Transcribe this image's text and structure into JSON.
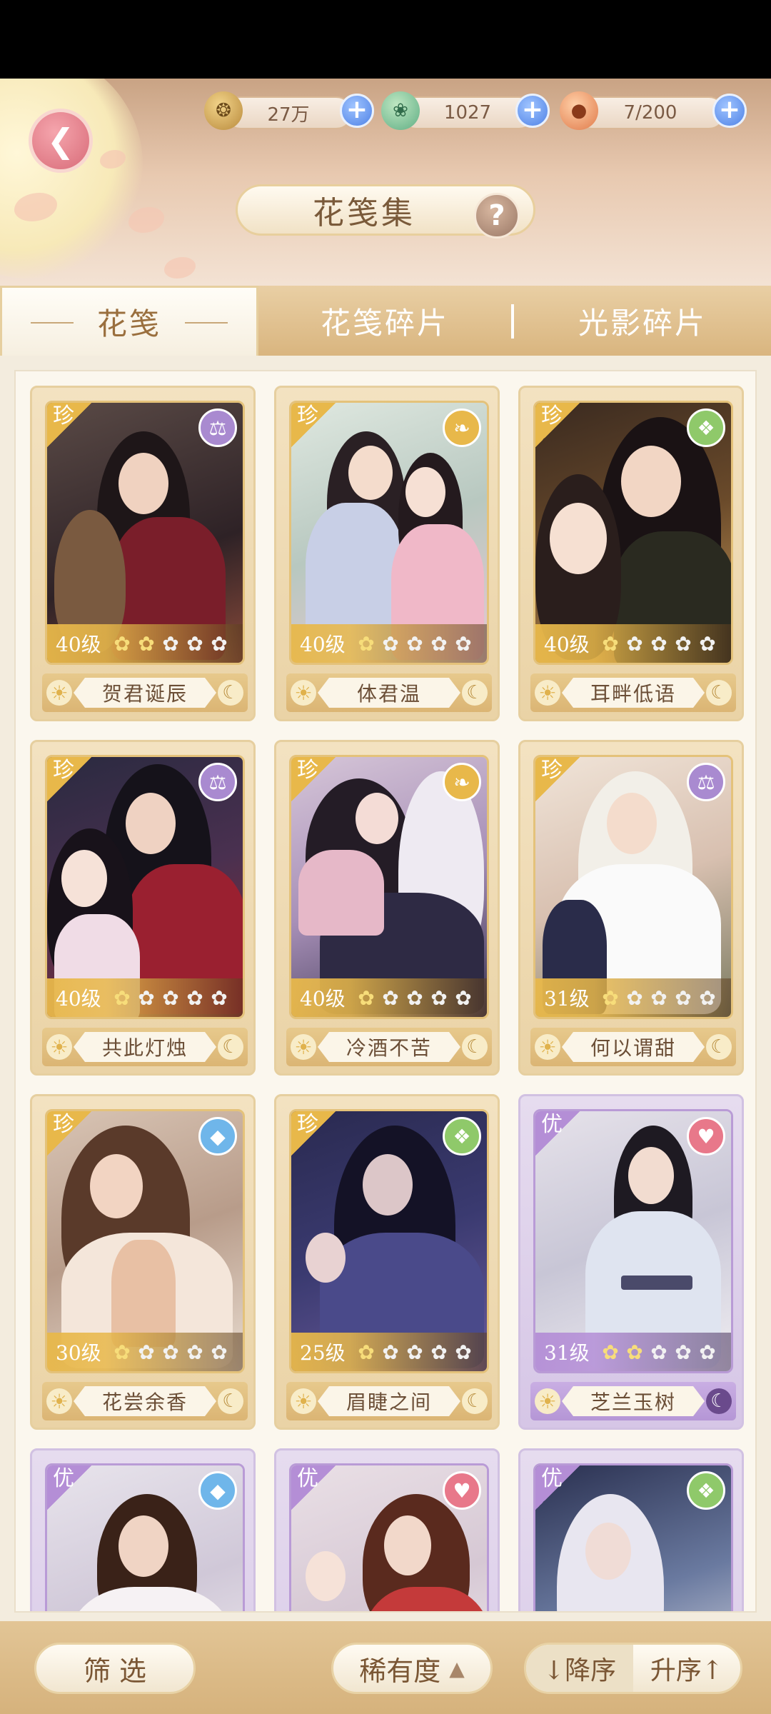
{
  "resources": [
    {
      "icon": "paw-coin-icon",
      "value": "27万"
    },
    {
      "icon": "jade-bird-icon",
      "value": "1027"
    },
    {
      "icon": "mooncake-icon",
      "value": "7/200"
    }
  ],
  "title": "花笺集",
  "help_label": "?",
  "tabs": [
    {
      "label": "花笺",
      "active": true
    },
    {
      "label": "花笺碎片",
      "active": false
    },
    {
      "label": "光影碎片",
      "active": false
    }
  ],
  "cards": [
    {
      "rarity": "珍",
      "element": "scales-icon",
      "level": "40级",
      "stars": 2,
      "name": "贺君诞辰",
      "moon": "gold"
    },
    {
      "rarity": "珍",
      "element": "bird-icon",
      "level": "40级",
      "stars": 1,
      "name": "体君温",
      "moon": "gold"
    },
    {
      "rarity": "珍",
      "element": "leaf-diamond-icon",
      "level": "40级",
      "stars": 1,
      "name": "耳畔低语",
      "moon": "gold"
    },
    {
      "rarity": "珍",
      "element": "scales-icon",
      "level": "40级",
      "stars": 1,
      "name": "共此灯烛",
      "moon": "gold"
    },
    {
      "rarity": "珍",
      "element": "bird-icon",
      "level": "40级",
      "stars": 1,
      "name": "冷酒不苦",
      "moon": "gold"
    },
    {
      "rarity": "珍",
      "element": "scales-icon",
      "level": "31级",
      "stars": 1,
      "name": "何以谓甜",
      "moon": "gold"
    },
    {
      "rarity": "珍",
      "element": "water-drop-icon",
      "level": "30级",
      "stars": 1,
      "name": "花尝余香",
      "moon": "gold"
    },
    {
      "rarity": "珍",
      "element": "leaf-diamond-icon",
      "level": "25级",
      "stars": 1,
      "name": "眉睫之间",
      "moon": "gold"
    },
    {
      "rarity": "优",
      "element": "heart-icon",
      "level": "31级",
      "stars": 2,
      "name": "芝兰玉树",
      "moon": "purple"
    },
    {
      "rarity": "优",
      "element": "water-drop-icon",
      "level": "",
      "stars": 0,
      "name": "",
      "moon": "purple"
    },
    {
      "rarity": "优",
      "element": "heart-icon",
      "level": "",
      "stars": 0,
      "name": "",
      "moon": "purple"
    },
    {
      "rarity": "优",
      "element": "leaf-diamond-icon",
      "level": "",
      "stars": 0,
      "name": "",
      "moon": "purple"
    }
  ],
  "bottom": {
    "filter_label": "筛 选",
    "rarity_label": "稀有度",
    "desc_label": "↓降序",
    "asc_label": "升序↑"
  },
  "colors": {
    "gold_frame": "#e8b84a",
    "purple_frame": "#b48ed6",
    "plus_blue": "#4f82e6",
    "back_pink": "#d86b78"
  }
}
